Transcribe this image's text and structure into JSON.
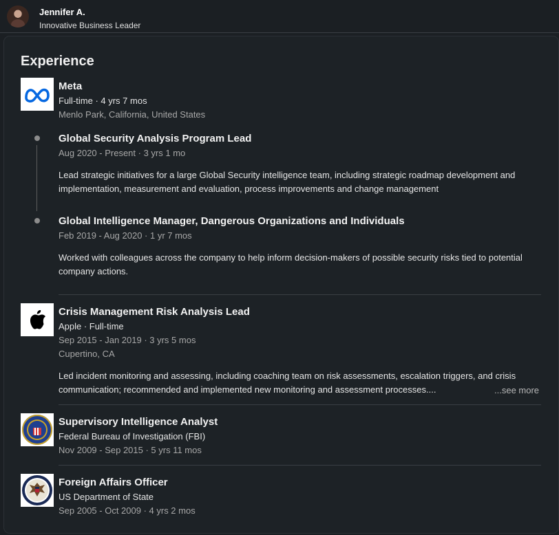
{
  "profile": {
    "name": "Jennifer A.",
    "headline": "Innovative Business Leader"
  },
  "experience": {
    "section_title": "Experience",
    "meta": {
      "company": "Meta",
      "employment": "Full-time · 4 yrs 7 mos",
      "location": "Menlo Park, California, United States",
      "logo": "meta-logo",
      "roles": [
        {
          "title": "Global Security Analysis Program Lead",
          "dates": "Aug 2020 - Present · 3 yrs 1 mo",
          "description": "Lead strategic initiatives for a large Global Security intelligence team, including strategic roadmap development and implementation, measurement and evaluation, process improvements and change management"
        },
        {
          "title": "Global Intelligence Manager, Dangerous Organizations and Individuals",
          "dates": "Feb 2019 - Aug 2020 · 1 yr 7 mos",
          "description": "Worked with colleagues across the company to help inform decision-makers of possible security risks tied to potential company actions."
        }
      ]
    },
    "apple": {
      "title": "Crisis Management Risk Analysis Lead",
      "company_type": "Apple · Full-time",
      "dates": "Sep 2015 - Jan 2019 · 3 yrs 5 mos",
      "location": "Cupertino, CA",
      "description": "Led incident monitoring and assessing, including coaching team on risk assessments, escalation triggers, and crisis communication; recommended and implemented new monitoring and assessment processes....",
      "see_more": "...see more",
      "logo": "apple-logo"
    },
    "fbi": {
      "title": "Supervisory Intelligence Analyst",
      "company": "Federal Bureau of Investigation (FBI)",
      "dates": "Nov 2009 - Sep 2015 · 5 yrs 11 mos",
      "logo": "fbi-seal-logo"
    },
    "state": {
      "title": "Foreign Affairs Officer",
      "company": "US Department of State",
      "dates": "Sep 2005 - Oct 2009 · 4 yrs 2 mos",
      "logo": "state-department-seal-logo"
    }
  },
  "colors": {
    "background": "#1b1f23",
    "card": "#1d2226",
    "meta_blue": "#0668e1",
    "fbi_blue": "#1f3f8f",
    "fbi_gold": "#c9a227"
  }
}
